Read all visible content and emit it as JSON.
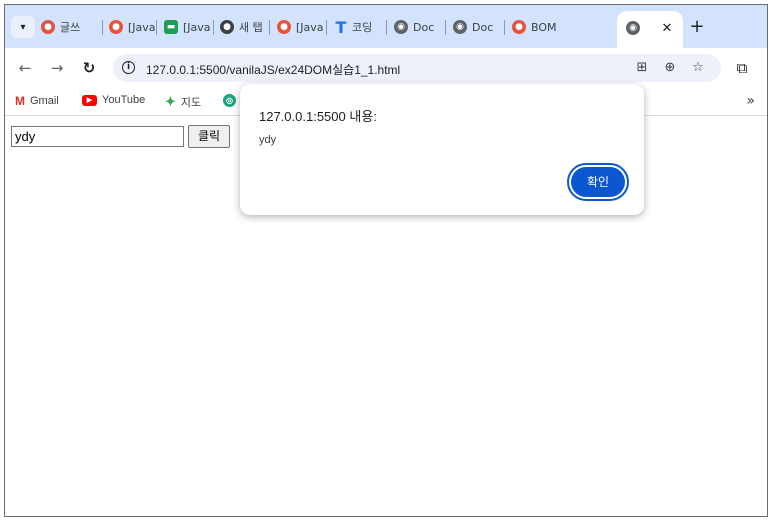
{
  "browser": {
    "tabs": [
      {
        "label": "글쓰",
        "favicon": "tistory-icon"
      },
      {
        "label": "[Java",
        "favicon": "tistory-icon"
      },
      {
        "label": "[Java",
        "favicon": "chat-icon"
      },
      {
        "label": "새 탭",
        "favicon": "github-icon"
      },
      {
        "label": "[Java",
        "favicon": "tistory-icon"
      },
      {
        "label": "코딩",
        "favicon": "t-icon"
      },
      {
        "label": "Doc",
        "favicon": "globe-icon"
      },
      {
        "label": "Doc",
        "favicon": "globe-icon"
      },
      {
        "label": "BOM",
        "favicon": "tistory-icon"
      }
    ],
    "active_tab": {
      "favicon": "globe-icon"
    },
    "url": "127.0.0.1:5500/vanilaJS/ex24DOM실습1_1.html",
    "bookmarks": [
      {
        "label": "Gmail",
        "icon": "gmail-icon"
      },
      {
        "label": "YouTube",
        "icon": "youtube-icon"
      },
      {
        "label": "지도",
        "icon": "maps-icon"
      },
      {
        "label": "",
        "icon": "chatgpt-icon"
      }
    ],
    "bookmarks_overflow": "»"
  },
  "page": {
    "input_value": "ydy",
    "button_label": "클릭"
  },
  "alert": {
    "title": "127.0.0.1:5500 내용:",
    "message": "ydy",
    "ok_label": "확인"
  },
  "colors": {
    "tabstrip": "#d3e3fd",
    "accent": "#0b57d0"
  }
}
